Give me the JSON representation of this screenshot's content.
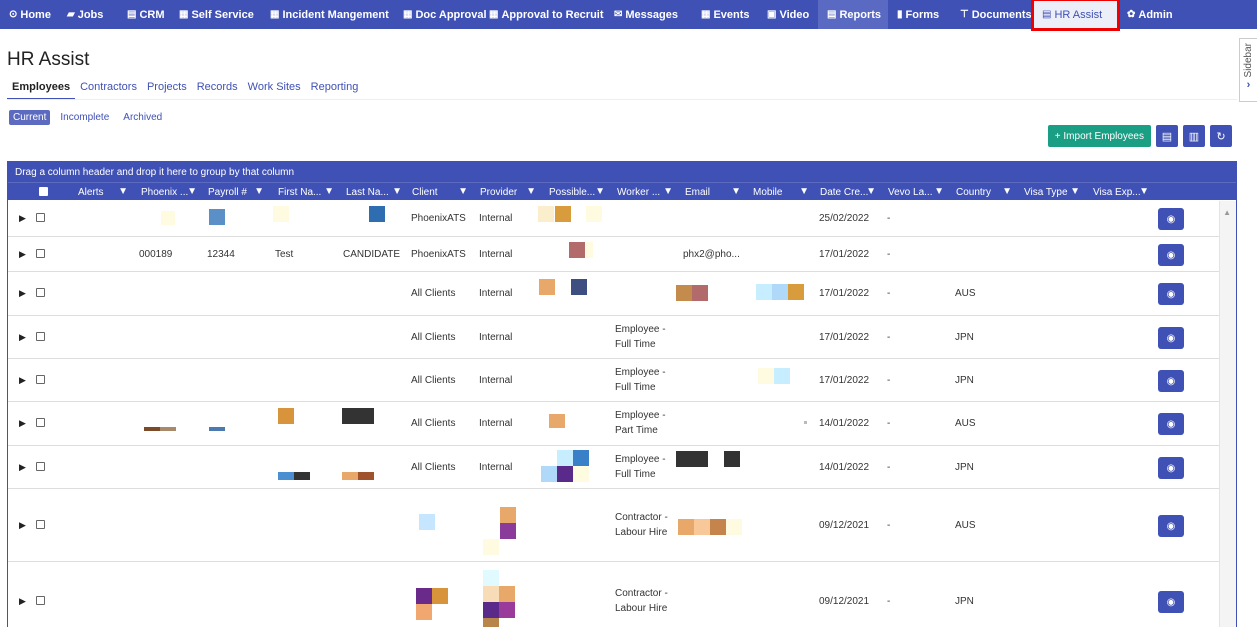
{
  "nav": {
    "items": [
      {
        "label": "Home",
        "icon": "⊙",
        "icon_name": "home-icon"
      },
      {
        "label": "Jobs",
        "icon": "▰",
        "icon_name": "folder-icon"
      },
      {
        "label": "CRM",
        "icon": "▤",
        "icon_name": "briefcase-icon"
      },
      {
        "label": "Self Service",
        "icon": "▦",
        "icon_name": "self-service-icon"
      },
      {
        "label": "Incident Mangement",
        "icon": "▦",
        "icon_name": "incident-icon"
      },
      {
        "label": "Doc Approval",
        "icon": "▦",
        "icon_name": "doc-approval-icon"
      },
      {
        "label": "Approval to Recruit",
        "icon": "▦",
        "icon_name": "approval-icon"
      },
      {
        "label": "Messages",
        "icon": "✉",
        "icon_name": "envelope-icon"
      },
      {
        "label": "Events",
        "icon": "▦",
        "icon_name": "calendar-icon"
      },
      {
        "label": "Video",
        "icon": "▣",
        "icon_name": "video-icon"
      },
      {
        "label": "Reports",
        "icon": "▤",
        "icon_name": "reports-icon"
      },
      {
        "label": "Forms",
        "icon": "▮",
        "icon_name": "forms-icon"
      },
      {
        "label": "Documents",
        "icon": "⊤",
        "icon_name": "documents-icon"
      },
      {
        "label": "HR Assist",
        "icon": "▤",
        "icon_name": "hr-assist-icon"
      },
      {
        "label": "Admin",
        "icon": "✿",
        "icon_name": "gear-icon"
      }
    ]
  },
  "sidebar_toggle": {
    "label": "Sidebar"
  },
  "page": {
    "title": "HR Assist"
  },
  "tabs": [
    "Employees",
    "Contractors",
    "Projects",
    "Records",
    "Work Sites",
    "Reporting"
  ],
  "subtabs": [
    "Current",
    "Incomplete",
    "Archived"
  ],
  "actions": {
    "import_label": "+ Import Employees"
  },
  "grid": {
    "group_hint": "Drag a column header and drop it here to group by that column",
    "headers": [
      "Alerts",
      "Phoenix ...",
      "Payroll #",
      "First Na...",
      "Last Na...",
      "Client",
      "Provider",
      "Possible...",
      "Worker ...",
      "Email",
      "Mobile",
      "Date Cre...",
      "Vevo La...",
      "Country",
      "Visa Type",
      "Visa Exp..."
    ],
    "rows": [
      {
        "phoenix": "",
        "payroll": "",
        "first": "",
        "last": "",
        "client": "PhoenixATS",
        "provider": "Internal",
        "worker1": "",
        "worker2": "",
        "email": "",
        "date": "25/02/2022",
        "vevo": "-",
        "country": ""
      },
      {
        "phoenix": "000189",
        "payroll": "12344",
        "first": "Test",
        "last": "CANDIDATE",
        "client": "PhoenixATS",
        "provider": "Internal",
        "worker1": "",
        "worker2": "",
        "email": "phx2@pho...",
        "date": "17/01/2022",
        "vevo": "-",
        "country": ""
      },
      {
        "phoenix": "",
        "payroll": "",
        "first": "",
        "last": "",
        "client": "All Clients",
        "provider": "Internal",
        "worker1": "",
        "worker2": "",
        "email": "",
        "date": "17/01/2022",
        "vevo": "-",
        "country": "AUS"
      },
      {
        "phoenix": "",
        "payroll": "",
        "first": "",
        "last": "",
        "client": "All Clients",
        "provider": "Internal",
        "worker1": "Employee -",
        "worker2": "Full Time",
        "email": "",
        "date": "17/01/2022",
        "vevo": "-",
        "country": "JPN"
      },
      {
        "phoenix": "",
        "payroll": "",
        "first": "",
        "last": "",
        "client": "All Clients",
        "provider": "Internal",
        "worker1": "Employee -",
        "worker2": "Full Time",
        "email": "",
        "date": "17/01/2022",
        "vevo": "-",
        "country": "JPN"
      },
      {
        "phoenix": "",
        "payroll": "",
        "first": "",
        "last": "",
        "client": "All Clients",
        "provider": "Internal",
        "worker1": "Employee -",
        "worker2": "Part Time",
        "email": "",
        "date": "14/01/2022",
        "vevo": "-",
        "country": "AUS"
      },
      {
        "phoenix": "",
        "payroll": "",
        "first": "",
        "last": "",
        "client": "All Clients",
        "provider": "Internal",
        "worker1": "Employee -",
        "worker2": "Full Time",
        "email": "",
        "date": "14/01/2022",
        "vevo": "-",
        "country": "JPN"
      },
      {
        "phoenix": "",
        "payroll": "",
        "first": "",
        "last": "",
        "client": "",
        "provider": "",
        "worker1": "Contractor -",
        "worker2": "Labour Hire",
        "email": "",
        "date": "09/12/2021",
        "vevo": "-",
        "country": "AUS"
      },
      {
        "phoenix": "",
        "payroll": "",
        "first": "",
        "last": "",
        "client": "",
        "provider": "",
        "worker1": "Contractor -",
        "worker2": "Labour Hire",
        "email": "",
        "date": "09/12/2021",
        "vevo": "-",
        "country": "JPN"
      }
    ]
  },
  "colors": {
    "primary": "#3f51b5",
    "import": "#1a9f84",
    "highlight": "#e00000"
  }
}
